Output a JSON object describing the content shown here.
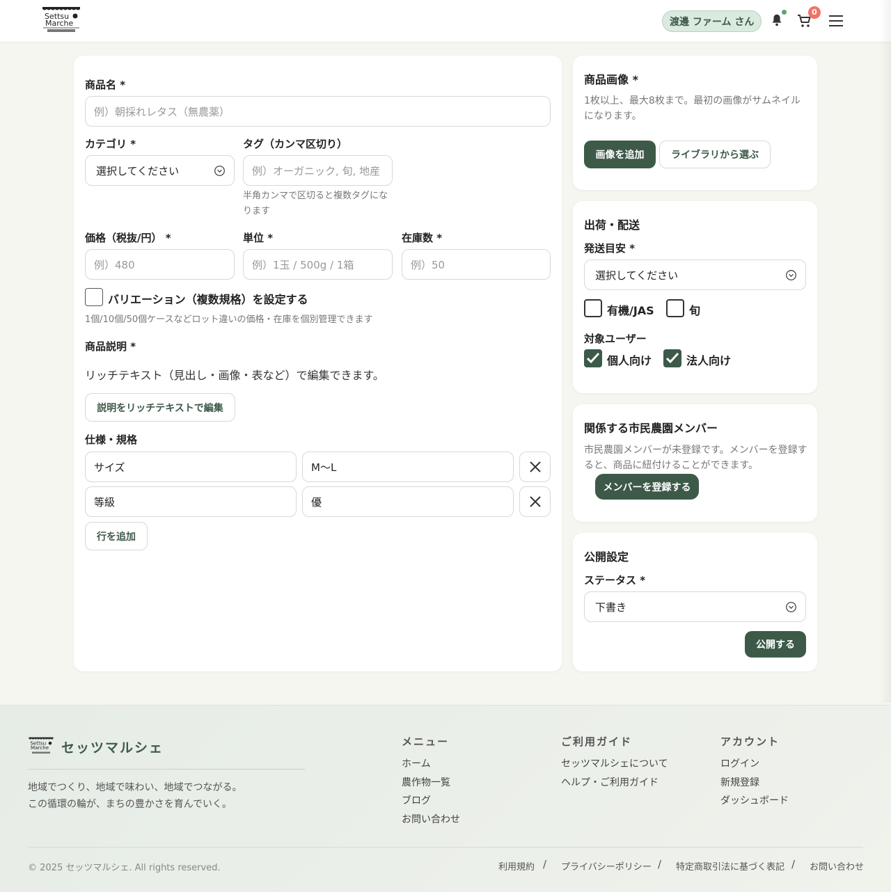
{
  "header": {
    "logo_text": "Settsu Marche セッツマルシェ",
    "user_name": "渡邊 ファーム さん",
    "cart_count": "0"
  },
  "form": {
    "product_name_label": "商品名 *",
    "product_name_placeholder": "例）朝採れレタス（無農薬）",
    "category_label": "カテゴリ *",
    "category_value": "選択してください",
    "tags_label": "タグ（カンマ区切り）",
    "tags_placeholder": "例）オーガニック, 旬, 地産",
    "tags_hint": "半角カンマで区切ると複数タグになります",
    "price_label": "価格（税抜/円） *",
    "price_placeholder": "例）480",
    "unit_label": "単位 *",
    "unit_placeholder": "例）1玉 / 500g / 1箱",
    "stock_label": "在庫数 *",
    "stock_placeholder": "例）50",
    "variation_label": "バリエーション（複数規格）を設定する",
    "variation_hint": "1個/10個/50個ケースなどロット違いの価格・在庫を個別管理できます",
    "description_label": "商品説明 *",
    "description_text": "リッチテキスト（見出し・画像・表など）で編集できます。",
    "description_button": "説明をリッチテキストで編集",
    "spec_label": "仕様・規格",
    "spec_rows": [
      {
        "key": "サイズ",
        "value": "M〜L"
      },
      {
        "key": "等級",
        "value": "優"
      }
    ],
    "add_row_button": "行を追加"
  },
  "images": {
    "title": "商品画像 *",
    "hint": "1枚以上、最大8枚まで。最初の画像がサムネイルになります。",
    "add_button": "画像を追加",
    "library_button": "ライブラリから選ぶ"
  },
  "shipping": {
    "title": "出荷・配送",
    "ship_label": "発送目安 *",
    "ship_value": "選択してください",
    "organic_label": "有機/JAS",
    "organic_checked": false,
    "season_label": "旬",
    "season_checked": false,
    "target_label": "対象ユーザー",
    "individual_label": "個人向け",
    "individual_checked": true,
    "business_label": "法人向け",
    "business_checked": true
  },
  "members": {
    "title": "関係する市民農園メンバー",
    "hint": "市民農園メンバーが未登録です。メンバーを登録すると、商品に紐付けることができます。",
    "register_button": "メンバーを登録する"
  },
  "publish": {
    "title": "公開設定",
    "status_label": "ステータス *",
    "status_value": "下書き",
    "publish_button": "公開する"
  },
  "footer": {
    "brand": "セッツマルシェ",
    "tagline_1": "地域でつくり、地域で味わい、地域でつながる。",
    "tagline_2": "この循環の輪が、まちの豊かさを育んでいく。",
    "menu_title": "メニュー",
    "menu_links": [
      "ホーム",
      "農作物一覧",
      "ブログ",
      "お問い合わせ"
    ],
    "guide_title": "ご利用ガイド",
    "guide_links": [
      "セッツマルシェについて",
      "ヘルプ・ご利用ガイド"
    ],
    "account_title": "アカウント",
    "account_links": [
      "ログイン",
      "新規登録",
      "ダッシュボード"
    ],
    "copyright": "© 2025 セッツマルシェ. All rights reserved.",
    "legal_links": [
      "利用規約",
      "プライバシーポリシー",
      "特定商取引法に基づく表記",
      "お問い合わせ"
    ]
  },
  "colors": {
    "brand": "#3d5a49",
    "badge": "#f07468",
    "pill_bg": "#dbeadf"
  }
}
